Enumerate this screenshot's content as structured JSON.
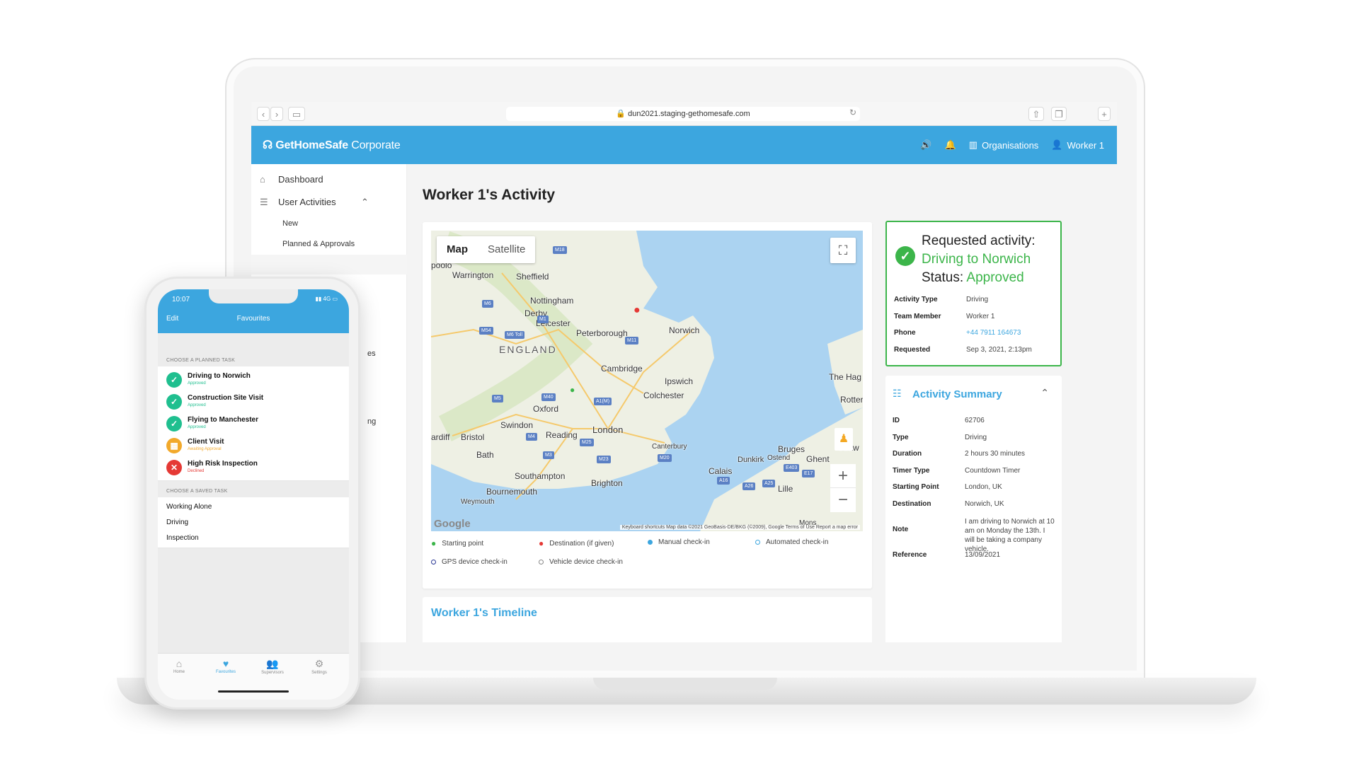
{
  "browser": {
    "url": "dun2021.staging-gethomesafe.com"
  },
  "app": {
    "brand_bold": "GetHomeSafe",
    "brand_thin": "Corporate",
    "header": {
      "organisations": "Organisations",
      "user": "Worker 1"
    }
  },
  "sidebar": {
    "dashboard": "Dashboard",
    "user_activities": "User Activities",
    "sub_new": "New",
    "sub_planned": "Planned & Approvals",
    "partial_es": "es",
    "partial_ng": "ng"
  },
  "main": {
    "title": "Worker 1's Activity",
    "timeline_title": "Worker 1's Timeline"
  },
  "map": {
    "tab_map": "Map",
    "tab_satellite": "Satellite",
    "google": "Google",
    "footer": "Keyboard shortcuts   Map data ©2021 GeoBasis-DE/BKG (©2009), Google   Terms of Use   Report a map error",
    "labels": {
      "pool": "poolo",
      "warrington": "Warrington",
      "sheffield": "Sheffield",
      "nottingham": "Nottingham",
      "derby": "Derby",
      "leicester": "Leicester",
      "england": "ENGLAND",
      "peterborough": "Peterborough",
      "norwich": "Norwich",
      "cambridge": "Cambridge",
      "ipswich": "Ipswich",
      "colchester": "Colchester",
      "oxford": "Oxford",
      "london": "London",
      "bristol": "Bristol",
      "cardiff": "ardiff",
      "swindon": "Swindon",
      "reading": "Reading",
      "bath": "Bath",
      "canterbury": "Canterbury",
      "southampton": "Southampton",
      "brighton": "Brighton",
      "bournemouth": "Bournemouth",
      "weymouth": "Weymouth",
      "calais": "Calais",
      "dunkirk": "Dunkirk",
      "ostend": "Ostend",
      "bruges": "Bruges",
      "ghent": "Ghent",
      "thehague": "The Hag",
      "rotter": "Rotter",
      "antw": "Antw",
      "lille": "Lille",
      "mons": "Mons"
    },
    "roads": [
      "M18",
      "M6",
      "M1",
      "M54",
      "M6 Toll",
      "M11",
      "M5",
      "M40",
      "A1(M)",
      "M4",
      "M25",
      "M3",
      "M23",
      "M20",
      "E403",
      "E17",
      "A26",
      "A25",
      "A16"
    ]
  },
  "legend": [
    {
      "label": "Starting point",
      "color": "#3cb54a",
      "shape": "pin"
    },
    {
      "label": "Destination (if given)",
      "color": "#e53935",
      "shape": "pin"
    },
    {
      "label": "Manual check-in",
      "color": "#3ca6df",
      "shape": "dot"
    },
    {
      "label": "Automated check-in",
      "color": "#3ca6df",
      "shape": "ring"
    },
    {
      "label": "GPS device check-in",
      "color": "#283593",
      "shape": "ring"
    },
    {
      "label": "Vehicle device check-in",
      "color": "#888888",
      "shape": "ring"
    }
  ],
  "request": {
    "line1": "Requested activity:",
    "line2": "Driving to Norwich",
    "status_label": "Status:",
    "status_value": "Approved",
    "rows": [
      {
        "k": "Activity Type",
        "v": "Driving"
      },
      {
        "k": "Team Member",
        "v": "Worker 1"
      },
      {
        "k": "Phone",
        "v": "+44 7911 164673"
      },
      {
        "k": "Requested",
        "v": "Sep 3, 2021, 2:13pm"
      }
    ]
  },
  "summary": {
    "title": "Activity Summary",
    "rows": [
      {
        "k": "ID",
        "v": "62706"
      },
      {
        "k": "Type",
        "v": "Driving"
      },
      {
        "k": "Duration",
        "v": "2 hours 30 minutes"
      },
      {
        "k": "Timer Type",
        "v": "Countdown Timer"
      },
      {
        "k": "Starting Point",
        "v": "London, UK"
      },
      {
        "k": "Destination",
        "v": "Norwich, UK"
      },
      {
        "k": "Note",
        "v": "I am driving to Norwich at 10 am on Monday the 13th. I will be taking a company vehicle."
      },
      {
        "k": "Reference",
        "v": "13/09/2021"
      }
    ]
  },
  "phone": {
    "time": "10:07",
    "signal": "4G",
    "edit": "Edit",
    "title": "Favourites",
    "planned_header": "CHOOSE A PLANNED TASK",
    "tasks": [
      {
        "name": "Driving to Norwich",
        "status": "Approved",
        "color": "#1fbf8f",
        "status_color": "#1fbf8f",
        "icon": "✓"
      },
      {
        "name": "Construction Site Visit",
        "status": "Approved",
        "color": "#1fbf8f",
        "status_color": "#1fbf8f",
        "icon": "✓"
      },
      {
        "name": "Flying to Manchester",
        "status": "Approved",
        "color": "#1fbf8f",
        "status_color": "#1fbf8f",
        "icon": "✓"
      },
      {
        "name": "Client Visit",
        "status": "Awaiting Approval",
        "color": "#f2a92b",
        "status_color": "#f2a92b",
        "icon": "▦"
      },
      {
        "name": "High Risk Inspection",
        "status": "Declined",
        "color": "#e53935",
        "status_color": "#e53935",
        "icon": "✕"
      }
    ],
    "saved_header": "CHOOSE A SAVED TASK",
    "saved": [
      "Working Alone",
      "Driving",
      "Inspection"
    ],
    "tabs": [
      "Home",
      "Favourites",
      "Supervisors",
      "Settings"
    ]
  }
}
